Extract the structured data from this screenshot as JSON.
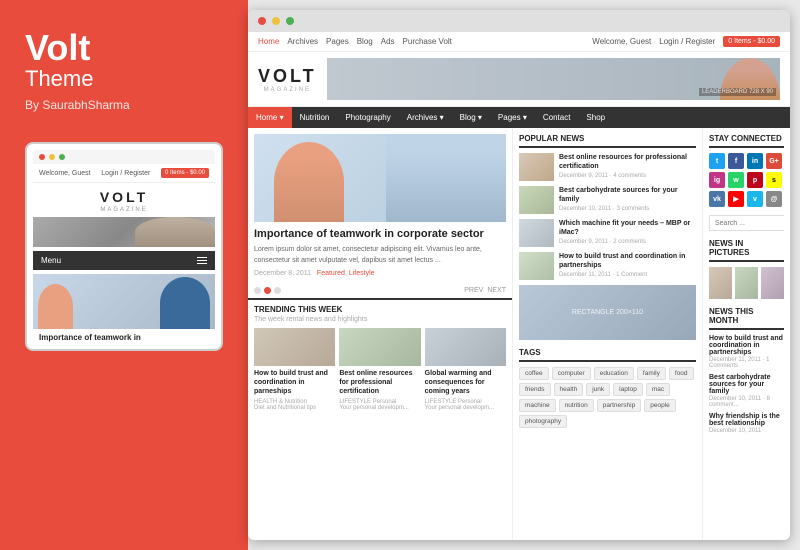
{
  "leftPanel": {
    "title": "Volt",
    "theme": "Theme",
    "author": "By SaurabhSharma",
    "mobile": {
      "welcome": "Welcome, Guest",
      "loginRegister": "Login / Register",
      "cartLabel": "0 Items - $0.00",
      "logoText": "VOLT",
      "logoSub": "MAGAZINE",
      "menuLabel": "Menu",
      "articleTitle": "Importance of teamwork in"
    }
  },
  "browser": {
    "topbar": {
      "navItems": [
        "Home",
        "Archives",
        "Pages",
        "Blog",
        "Ads",
        "Purchase Volt"
      ],
      "welcome": "Welcome, Guest",
      "loginRegister": "Login / Register",
      "cartLabel": "0 Items - $0.00"
    },
    "header": {
      "logoText": "VOLT",
      "logoSub": "MAGAZINE",
      "bannerText": "LEADERBOARD 728 X 90"
    },
    "mainNav": {
      "items": [
        "Home",
        "Nutrition",
        "Photography",
        "Archives",
        "Blog",
        "Pages",
        "Contact",
        "Shop"
      ]
    },
    "featuredArticle": {
      "title": "Importance of teamwork in corporate sector",
      "body": "Lorem ipsum dolor sit amet, consectetur adipiscing elit. Vivamus leo ante, consectetur sit amet vulputate vel, dapibus sit amet lectus ...",
      "date": "December 8, 2011",
      "categories": [
        "Featured",
        "Lifestyle"
      ],
      "prevLabel": "PREV",
      "nextLabel": "NEXT"
    },
    "trending": {
      "sectionTitle": "TRENDING this week",
      "subtitle": "The week rental news and highlights",
      "items": [
        {
          "title": "How to build trust and coordination in parneships",
          "category": "HEALTH & Nutrition",
          "catSub": "Diet and Nutritional tips"
        },
        {
          "title": "Best online resources for professional certification",
          "category": "LIFESTYLE Personal",
          "catSub": "Your personal developm..."
        },
        {
          "title": "Global warming and consequences for coming years",
          "category": "LIFESTYLE Personal",
          "catSub": "Your personal developm..."
        }
      ]
    },
    "popularNews": {
      "sectionTitle": "POPULAR NEWS",
      "items": [
        {
          "title": "Best online resources for professional certification",
          "date": "December 9, 2011",
          "comments": "4 comments"
        },
        {
          "title": "Best carbohydrate sources for your family",
          "date": "December 10, 2011",
          "comments": "3 comments"
        },
        {
          "title": "Which machine fit your needs – MBP or iMac?",
          "date": "December 9, 2011",
          "comments": "2 comments"
        },
        {
          "title": "How to build trust and coordination in partnerships",
          "date": "December 11, 2011",
          "comments": "1 Comment"
        }
      ]
    },
    "tags": {
      "sectionTitle": "TAGS",
      "items": [
        "coffee",
        "computer",
        "education",
        "family",
        "food",
        "friends",
        "health",
        "junk",
        "laptop",
        "mac",
        "machine",
        "nutrition",
        "partnership",
        "people",
        "photography"
      ]
    },
    "stayConnected": {
      "sectionTitle": "STAY CONNECTED",
      "icons": [
        {
          "name": "twitter",
          "label": "t",
          "class": "si-tw"
        },
        {
          "name": "facebook",
          "label": "f",
          "class": "si-fb"
        },
        {
          "name": "linkedin",
          "label": "in",
          "class": "si-li"
        },
        {
          "name": "google-plus",
          "label": "G+",
          "class": "si-gp"
        },
        {
          "name": "instagram",
          "label": "ig",
          "class": "si-ig"
        },
        {
          "name": "whatsapp",
          "label": "w",
          "class": "si-wa"
        },
        {
          "name": "pinterest",
          "label": "p",
          "class": "si-pi"
        },
        {
          "name": "snapchat",
          "label": "s",
          "class": "si-sc"
        },
        {
          "name": "vk",
          "label": "vk",
          "class": "si-vk"
        },
        {
          "name": "youtube",
          "label": "yt",
          "class": "si-yt"
        },
        {
          "name": "vimeo",
          "label": "v",
          "class": "si-vi"
        },
        {
          "name": "email",
          "label": "@",
          "class": "si-em"
        }
      ]
    },
    "searchBox": {
      "placeholder": "Search ...",
      "buttonLabel": "🔍"
    },
    "newsInPictures": {
      "sectionTitle": "NEWS IN PICTURES"
    },
    "newsThisMonth": {
      "sectionTitle": "NEWS THIS MONTH",
      "items": [
        {
          "title": "How to build trust and coordination in partnerships",
          "date": "December 11, 2011",
          "comments": "1 Comments"
        },
        {
          "title": "Best carbohydrate sources for your family",
          "date": "December 10, 2011",
          "comments": "8 comment..."
        },
        {
          "title": "Why friendship is the best relationship",
          "date": "December 10, 2011",
          "comments": ""
        }
      ]
    }
  },
  "colors": {
    "accent": "#e84c3d",
    "navBg": "#333333",
    "tagBg": "#f0f0f0"
  }
}
